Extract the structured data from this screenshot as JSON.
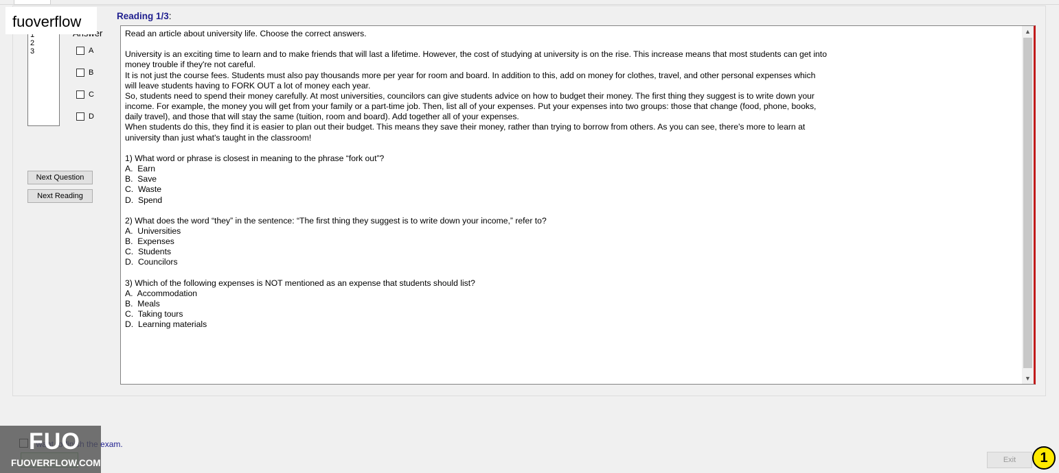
{
  "brand": {
    "label": "fuoverflow"
  },
  "question_list": {
    "items": [
      "1",
      "2",
      "3"
    ]
  },
  "answer_panel": {
    "label": "Answer",
    "options": [
      "A",
      "B",
      "C",
      "D"
    ]
  },
  "buttons": {
    "next_question": "Next Question",
    "next_reading": "Next Reading",
    "exit": "Exit"
  },
  "reading": {
    "title": "Reading 1/3",
    "colon": ":",
    "text": "Read an article about university life. Choose the correct answers.\n\nUniversity is an exciting time to learn and to make friends that will last a lifetime. However, the cost of studying at university is on the rise. This increase means that most students can get into\nmoney trouble if they're not careful.\nIt is not just the course fees. Students must also pay thousands more per year for room and board. In addition to this, add on money for clothes, travel, and other personal expenses which\nwill leave students having to FORK OUT a lot of money each year.\nSo, students need to spend their money carefully. At most universities, councilors can give students advice on how to budget their money. The first thing they suggest is to write down your\nincome. For example, the money you will get from your family or a part-time job. Then, list all of your expenses. Put your expenses into two groups: those that change (food, phone, books,\ndaily travel), and those that will stay the same (tuition, room and board). Add together all of your expenses.\nWhen students do this, they find it is easier to plan out their budget. This means they save their money, rather than trying to borrow from others. As you can see, there's more to learn at\nuniversity than just what's taught in the classroom!\n\n1) What word or phrase is closest in meaning to the phrase “fork out”?\nA.  Earn\nB.  Save\nC.  Waste\nD.  Spend\n\n2) What does the word “they” in the sentence: “The first thing they suggest is to write down your income,” refer to?\nA.  Universities\nB.  Expenses\nC.  Students\nD.  Councilors\n\n3) Which of the following expenses is NOT mentioned as an expense that students should list?\nA.  Accommodation\nB.  Meals\nC.  Taking tours\nD.  Learning materials"
  },
  "finish": {
    "label": "I want to finish the exam."
  },
  "logo": {
    "main": "FUO",
    "sub": "FUOVERFLOW.COM"
  },
  "badge": {
    "label": "1"
  },
  "colors": {
    "title_blue": "#1f1f8f",
    "border_red": "#c01b1b",
    "badge_yellow": "#ffea00"
  }
}
